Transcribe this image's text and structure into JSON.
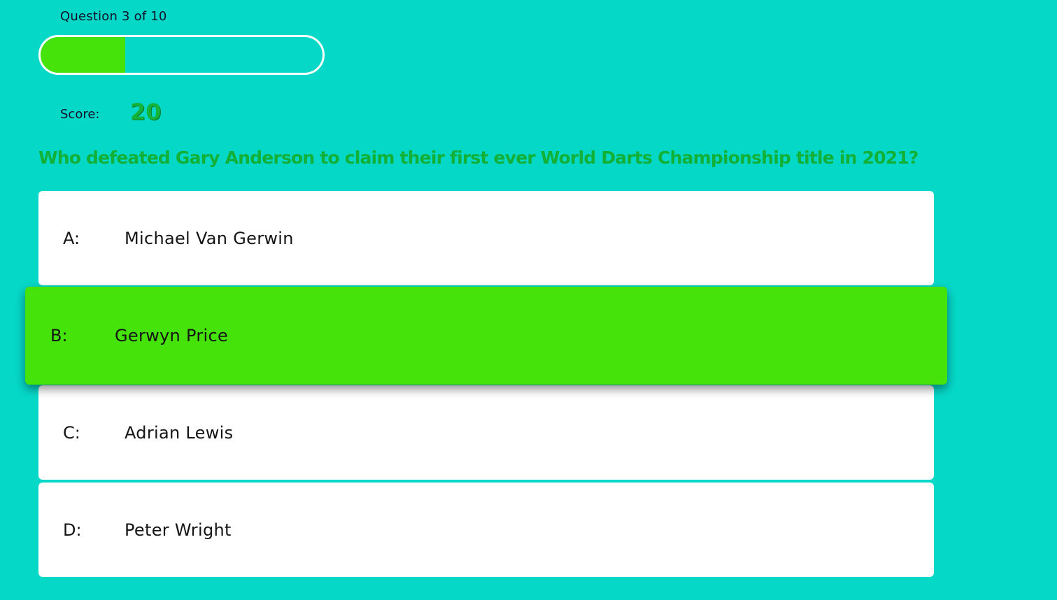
{
  "hud": {
    "progress_text": "Question 3 of 10",
    "progress_fraction": 0.3,
    "score_label": "Score:",
    "score_value": "20"
  },
  "question": {
    "text": "Who defeated Gary Anderson to claim their first ever World Darts Championship title in 2021?"
  },
  "choices": [
    {
      "prefix": "A:",
      "text": "Michael Van Gerwin",
      "state": "default"
    },
    {
      "prefix": "B:",
      "text": "Gerwyn Price",
      "state": "hover"
    },
    {
      "prefix": "C:",
      "text": "Adrian Lewis",
      "state": "default"
    },
    {
      "prefix": "D:",
      "text": "Peter Wright",
      "state": "default"
    }
  ],
  "colors": {
    "background": "#06d8c8",
    "progress_fill": "#45e30a",
    "accent_green": "#12b036",
    "choice_bg": "#ffffff",
    "choice_hover_bg": "#45e30a"
  }
}
